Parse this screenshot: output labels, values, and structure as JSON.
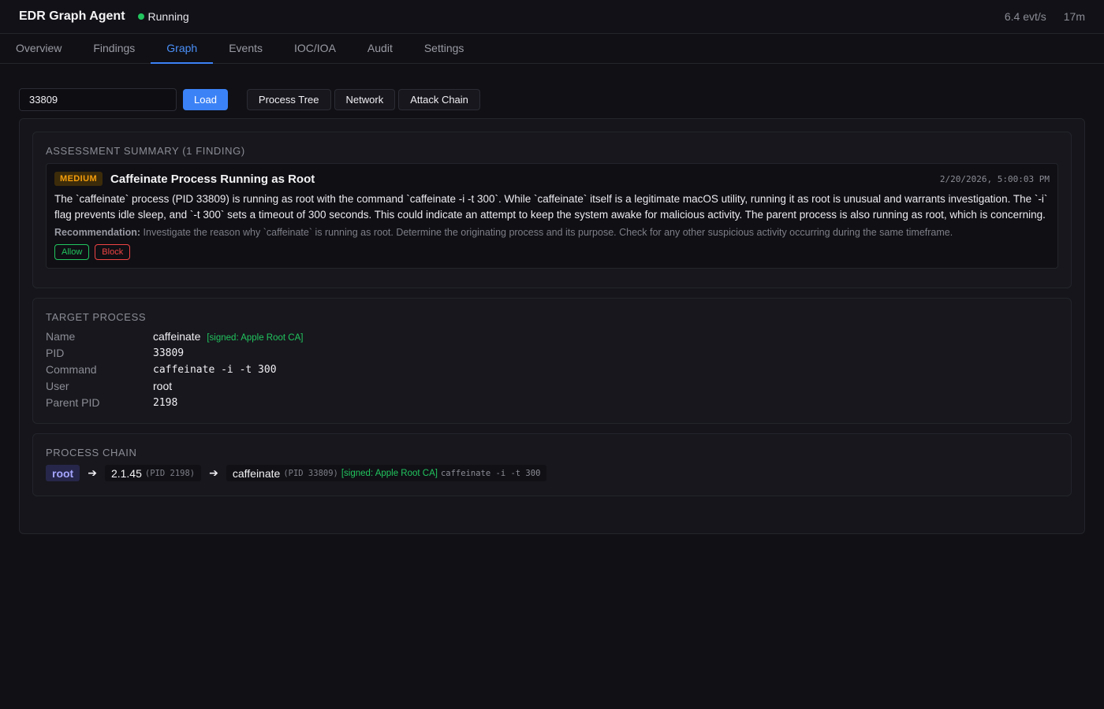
{
  "app": {
    "title": "EDR Graph Agent",
    "status": "Running",
    "status_color": "#22c55e",
    "rate": "6.4 evt/s",
    "uptime": "17m"
  },
  "tabs": [
    {
      "label": "Overview"
    },
    {
      "label": "Findings"
    },
    {
      "label": "Graph",
      "active": true
    },
    {
      "label": "Events"
    },
    {
      "label": "IOC/IOA"
    },
    {
      "label": "Audit"
    },
    {
      "label": "Settings"
    }
  ],
  "controls": {
    "pid_value": "33809",
    "load_label": "Load",
    "views": [
      "Process Tree",
      "Network",
      "Attack Chain"
    ]
  },
  "assessment": {
    "title": "ASSESSMENT SUMMARY (1 FINDING)",
    "finding": {
      "severity": "MEDIUM",
      "title": "Caffeinate Process Running as Root",
      "time": "2/20/2026, 5:00:03 PM",
      "description": "The `caffeinate` process (PID 33809) is running as root with the command `caffeinate -i -t 300`. While `caffeinate` itself is a legitimate macOS utility, running it as root is unusual and warrants investigation. The `-i` flag prevents idle sleep, and `-t 300` sets a timeout of 300 seconds. This could indicate an attempt to keep the system awake for malicious activity. The parent process is also running as root, which is concerning.",
      "recommendation_label": "Recommendation:",
      "recommendation": "Investigate the reason why `caffeinate` is running as root. Determine the originating process and its purpose. Check for any other suspicious activity occurring during the same timeframe.",
      "allow_label": "Allow",
      "block_label": "Block"
    }
  },
  "target": {
    "title": "TARGET PROCESS",
    "rows": [
      {
        "key": "Name",
        "value": "caffeinate",
        "signed": "[signed: Apple Root CA]"
      },
      {
        "key": "PID",
        "value": "33809"
      },
      {
        "key": "Command",
        "value": "caffeinate -i -t 300"
      },
      {
        "key": "User",
        "value": "root"
      },
      {
        "key": "Parent PID",
        "value": "2198"
      }
    ]
  },
  "chain": {
    "title": "PROCESS CHAIN",
    "root": "root",
    "arrow": "➔",
    "nodes": [
      {
        "name": "2.1.45",
        "pid": "(PID 2198)"
      },
      {
        "name": "caffeinate",
        "pid": "(PID 33809)",
        "signed": "[signed: Apple Root CA]",
        "cmd": "caffeinate -i -t 300"
      }
    ]
  }
}
